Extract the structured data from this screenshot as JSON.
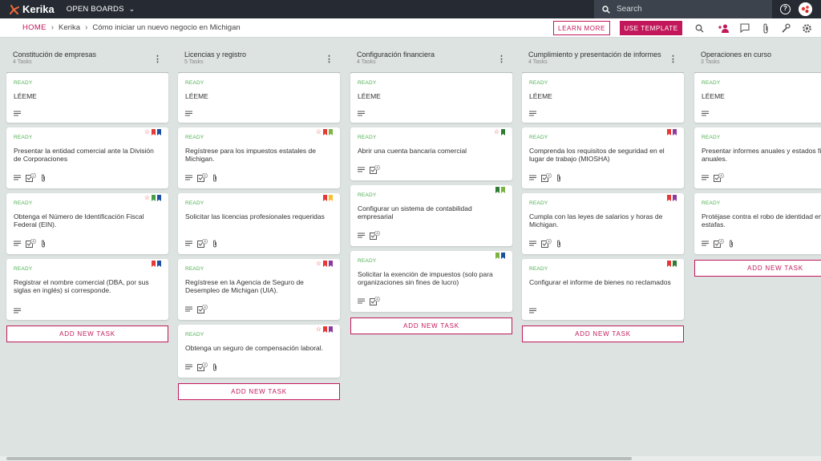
{
  "app": {
    "name": "Kerika",
    "open_boards_label": "OPEN BOARDS",
    "search_placeholder": "Search"
  },
  "breadcrumb": {
    "home": "HOME",
    "items": [
      "Kerika",
      "Cómo iniciar un nuevo negocio en Michigan"
    ]
  },
  "actions": {
    "learn_more": "LEARN MORE",
    "use_template": "USE TEMPLATE"
  },
  "add_task_label": "ADD NEW TASK",
  "colors": {
    "accent": "#c2185b",
    "topbar": "#262b33",
    "ready": "#4caf50",
    "board_bg": "#dde3e1"
  },
  "columns": [
    {
      "title": "Constitución de empresas",
      "count": "4 Tasks",
      "cards": [
        {
          "status": "READY",
          "title": "LÉEME",
          "flags": [],
          "star": false,
          "icons": [
            "notes"
          ]
        },
        {
          "status": "READY",
          "title": "Presentar la entidad comercial ante la División de Corporaciones",
          "flags": [
            "#e53935",
            "#1e4fa0"
          ],
          "star": true,
          "icons": [
            "notes",
            "checklist-2",
            "attachment"
          ]
        },
        {
          "status": "READY",
          "title": "Obtenga el Número de Identificación Fiscal Federal (EIN).",
          "flags": [
            "#43a047",
            "#1e4fa0"
          ],
          "star": true,
          "icons": [
            "notes",
            "checklist-4",
            "attachment"
          ]
        },
        {
          "status": "READY",
          "title": "Registrar el nombre comercial (DBA, por sus siglas en inglés) si corresponde.",
          "flags": [
            "#e53935",
            "#1e4fa0"
          ],
          "star": false,
          "icons": [
            "notes"
          ]
        }
      ]
    },
    {
      "title": "Licencias y registro",
      "count": "5 Tasks",
      "cards": [
        {
          "status": "READY",
          "title": "LÉEME",
          "flags": [],
          "star": false,
          "icons": [
            "notes"
          ]
        },
        {
          "status": "READY",
          "title": "Regístrese para los impuestos estatales de Michigan.",
          "flags": [
            "#e53935",
            "#7cb342"
          ],
          "star": true,
          "icons": [
            "notes",
            "checklist-6",
            "attachment"
          ]
        },
        {
          "status": "READY",
          "title": "Solicitar las licencias profesionales requeridas",
          "flags": [
            "#e53935",
            "#fbc02d"
          ],
          "star": false,
          "icons": [
            "notes",
            "checklist-4",
            "attachment"
          ]
        },
        {
          "status": "READY",
          "title": "Regístrese en la Agencia de Seguro de Desempleo de Michigan (UIA).",
          "flags": [
            "#e53935",
            "#8e3a9d"
          ],
          "star": true,
          "icons": [
            "notes",
            "checklist-4"
          ]
        },
        {
          "status": "READY",
          "title": "Obtenga un seguro de compensación laboral.",
          "flags": [
            "#e53935",
            "#8e3a9d"
          ],
          "star": true,
          "icons": [
            "notes",
            "checklist-4",
            "attachment"
          ]
        }
      ]
    },
    {
      "title": "Configuración financiera",
      "count": "4 Tasks",
      "cards": [
        {
          "status": "READY",
          "title": "LÉEME",
          "flags": [],
          "star": false,
          "icons": [
            "notes"
          ]
        },
        {
          "status": "READY",
          "title": "Abrir una cuenta bancaria comercial",
          "flags": [
            "#2e7d32"
          ],
          "star": true,
          "icons": [
            "notes",
            "checklist-4"
          ]
        },
        {
          "status": "READY",
          "title": "Configurar un sistema de contabilidad empresarial",
          "flags": [
            "#2e7d32",
            "#7cb342"
          ],
          "star": false,
          "icons": [
            "notes",
            "checklist-4"
          ]
        },
        {
          "status": "READY",
          "title": "Solicitar la exención de impuestos (solo para organizaciones sin fines de lucro)",
          "flags": [
            "#7cb342",
            "#1e4fa0"
          ],
          "star": false,
          "icons": [
            "notes",
            "checklist-4"
          ]
        }
      ]
    },
    {
      "title": "Cumplimiento y presentación de informes",
      "count": "4 Tasks",
      "cards": [
        {
          "status": "READY",
          "title": "LÉEME",
          "flags": [],
          "star": false,
          "icons": [
            "notes"
          ]
        },
        {
          "status": "READY",
          "title": "Comprenda los requisitos de seguridad en el lugar de trabajo (MIOSHA)",
          "flags": [
            "#e53935",
            "#8e3a9d"
          ],
          "star": false,
          "icons": [
            "notes",
            "checklist-4",
            "attachment"
          ]
        },
        {
          "status": "READY",
          "title": "Cumpla con las leyes de salarios y horas de Michigan.",
          "flags": [
            "#e53935",
            "#8e3a9d"
          ],
          "star": false,
          "icons": [
            "notes",
            "checklist-4",
            "attachment"
          ]
        },
        {
          "status": "READY",
          "title": "Configurar el informe de bienes no reclamados",
          "flags": [
            "#e53935",
            "#2e7d32"
          ],
          "star": false,
          "icons": [
            "notes"
          ]
        }
      ]
    },
    {
      "title": "Operaciones en curso",
      "count": "3 Tasks",
      "cards": [
        {
          "status": "READY",
          "title": "LÉEME",
          "flags": [],
          "star": false,
          "icons": [
            "notes"
          ]
        },
        {
          "status": "READY",
          "title": "Presentar informes anuales y estados fin anuales.",
          "flags": [],
          "star": false,
          "icons": [
            "notes",
            "checklist-4"
          ]
        },
        {
          "status": "READY",
          "title": "Protéjase contra el robo de identidad em y las estafas.",
          "flags": [],
          "star": false,
          "icons": [
            "notes",
            "checklist-4",
            "attachment"
          ]
        }
      ]
    }
  ]
}
